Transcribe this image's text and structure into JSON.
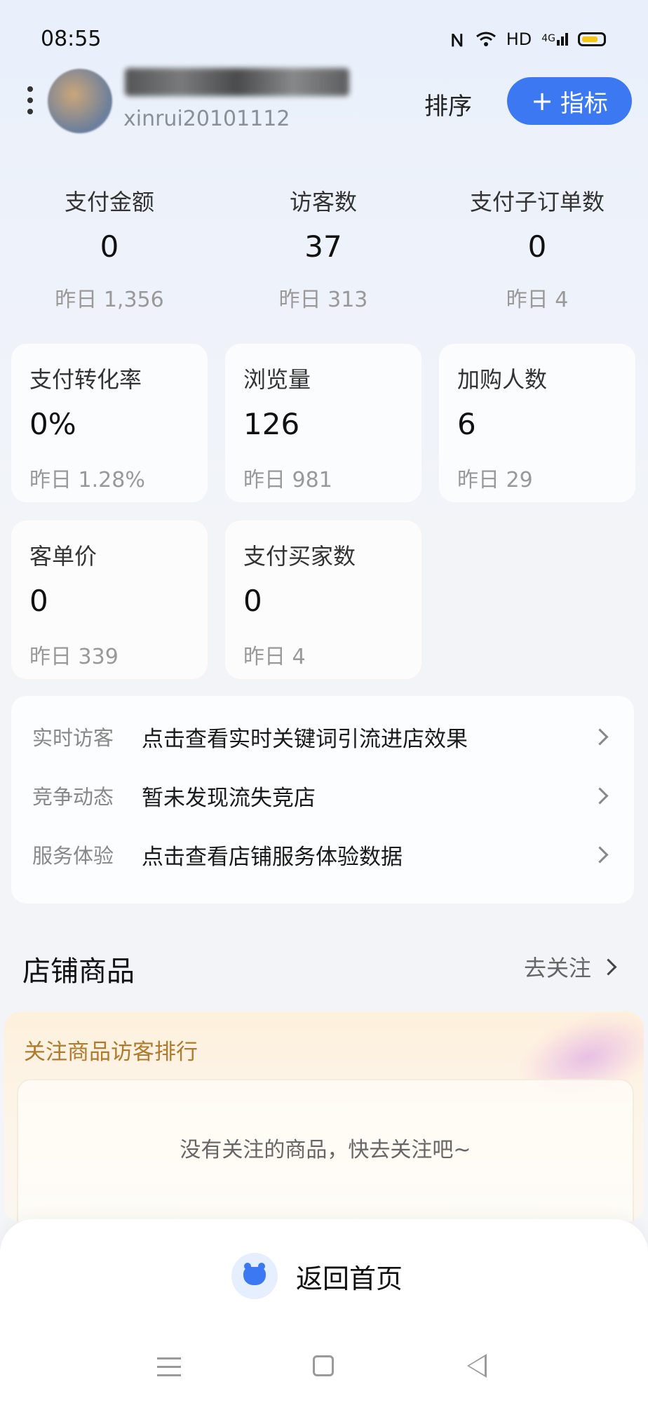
{
  "status_bar": {
    "time": "08:55",
    "network": "HD",
    "signal": "4G"
  },
  "header": {
    "store_id": "xinrui20101112",
    "sort_label": "排序",
    "add_metric_label": "指标"
  },
  "top_metrics": [
    {
      "label": "支付金额",
      "value": "0",
      "yesterday": "昨日 1,356"
    },
    {
      "label": "访客数",
      "value": "37",
      "yesterday": "昨日 313"
    },
    {
      "label": "支付子订单数",
      "value": "0",
      "yesterday": "昨日 4"
    }
  ],
  "cards": [
    {
      "label": "支付转化率",
      "value": "0%",
      "yesterday": "昨日 1.28%"
    },
    {
      "label": "浏览量",
      "value": "126",
      "yesterday": "昨日 981"
    },
    {
      "label": "加购人数",
      "value": "6",
      "yesterday": "昨日 29"
    },
    {
      "label": "客单价",
      "value": "0",
      "yesterday": "昨日 339"
    },
    {
      "label": "支付买家数",
      "value": "0",
      "yesterday": "昨日 4"
    }
  ],
  "insights": [
    {
      "key": "实时访客",
      "text": "点击查看实时关键词引流进店效果"
    },
    {
      "key": "竞争动态",
      "text": "暂未发现流失竞店"
    },
    {
      "key": "服务体验",
      "text": "点击查看店铺服务体验数据"
    }
  ],
  "goods": {
    "title": "店铺商品",
    "follow_label": "去关注",
    "rank_title": "关注商品访客排行",
    "empty_text": "没有关注的商品，快去关注吧~"
  },
  "bottom": {
    "home_label": "返回首页"
  },
  "colors": {
    "accent": "#3b78f2",
    "rank_title": "#b07a2c"
  }
}
